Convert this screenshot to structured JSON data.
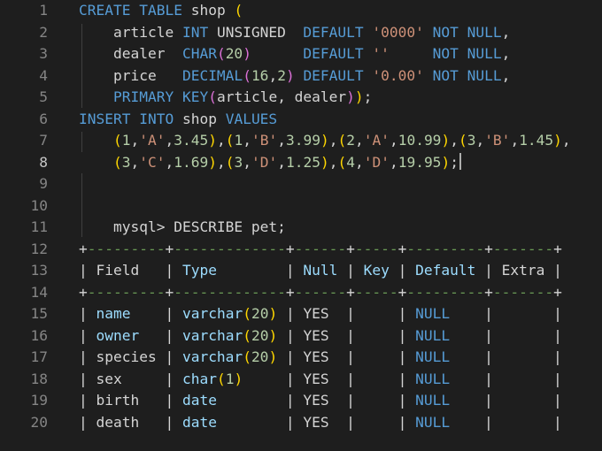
{
  "editor": {
    "current_line": 8,
    "lines": [
      {
        "n": "1",
        "tokens": [
          {
            "t": "CREATE",
            "c": "kw"
          },
          {
            "t": " ",
            "c": "pl"
          },
          {
            "t": "TABLE",
            "c": "kw"
          },
          {
            "t": " shop ",
            "c": "pl"
          },
          {
            "t": "(",
            "c": "br1"
          }
        ]
      },
      {
        "n": "2",
        "tokens": [
          {
            "t": "    article ",
            "c": "pl"
          },
          {
            "t": "INT",
            "c": "kw"
          },
          {
            "t": " UNSIGNED  ",
            "c": "pl"
          },
          {
            "t": "DEFAULT",
            "c": "kw"
          },
          {
            "t": " ",
            "c": "pl"
          },
          {
            "t": "'0000'",
            "c": "st"
          },
          {
            "t": " ",
            "c": "pl"
          },
          {
            "t": "NOT",
            "c": "kw"
          },
          {
            "t": " ",
            "c": "pl"
          },
          {
            "t": "NULL",
            "c": "kw"
          },
          {
            "t": ",",
            "c": "pl"
          }
        ]
      },
      {
        "n": "3",
        "tokens": [
          {
            "t": "    dealer  ",
            "c": "pl"
          },
          {
            "t": "CHAR",
            "c": "kw"
          },
          {
            "t": "(",
            "c": "br2"
          },
          {
            "t": "20",
            "c": "nu"
          },
          {
            "t": ")",
            "c": "br2"
          },
          {
            "t": "      ",
            "c": "pl"
          },
          {
            "t": "DEFAULT",
            "c": "kw"
          },
          {
            "t": " ",
            "c": "pl"
          },
          {
            "t": "''",
            "c": "st"
          },
          {
            "t": "     ",
            "c": "pl"
          },
          {
            "t": "NOT",
            "c": "kw"
          },
          {
            "t": " ",
            "c": "pl"
          },
          {
            "t": "NULL",
            "c": "kw"
          },
          {
            "t": ",",
            "c": "pl"
          }
        ]
      },
      {
        "n": "4",
        "tokens": [
          {
            "t": "    price   ",
            "c": "pl"
          },
          {
            "t": "DECIMAL",
            "c": "kw"
          },
          {
            "t": "(",
            "c": "br2"
          },
          {
            "t": "16",
            "c": "nu"
          },
          {
            "t": ",",
            "c": "pl"
          },
          {
            "t": "2",
            "c": "nu"
          },
          {
            "t": ")",
            "c": "br2"
          },
          {
            "t": " ",
            "c": "pl"
          },
          {
            "t": "DEFAULT",
            "c": "kw"
          },
          {
            "t": " ",
            "c": "pl"
          },
          {
            "t": "'0.00'",
            "c": "st"
          },
          {
            "t": " ",
            "c": "pl"
          },
          {
            "t": "NOT",
            "c": "kw"
          },
          {
            "t": " ",
            "c": "pl"
          },
          {
            "t": "NULL",
            "c": "kw"
          },
          {
            "t": ",",
            "c": "pl"
          }
        ]
      },
      {
        "n": "5",
        "tokens": [
          {
            "t": "    ",
            "c": "pl"
          },
          {
            "t": "PRIMARY",
            "c": "kw"
          },
          {
            "t": " ",
            "c": "pl"
          },
          {
            "t": "KEY",
            "c": "kw"
          },
          {
            "t": "(",
            "c": "br2"
          },
          {
            "t": "article, dealer",
            "c": "pl"
          },
          {
            "t": ")",
            "c": "br2"
          },
          {
            "t": ")",
            "c": "br1"
          },
          {
            "t": ";",
            "c": "pl"
          }
        ]
      },
      {
        "n": "6",
        "tokens": [
          {
            "t": "INSERT",
            "c": "kw"
          },
          {
            "t": " ",
            "c": "pl"
          },
          {
            "t": "INTO",
            "c": "kw"
          },
          {
            "t": " shop ",
            "c": "pl"
          },
          {
            "t": "VALUES",
            "c": "kw"
          }
        ]
      },
      {
        "n": "7",
        "tokens": [
          {
            "t": "    ",
            "c": "pl"
          },
          {
            "t": "(",
            "c": "br1"
          },
          {
            "t": "1",
            "c": "nu"
          },
          {
            "t": ",",
            "c": "pl"
          },
          {
            "t": "'A'",
            "c": "st"
          },
          {
            "t": ",",
            "c": "pl"
          },
          {
            "t": "3.45",
            "c": "nu"
          },
          {
            "t": ")",
            "c": "br1"
          },
          {
            "t": ",",
            "c": "pl"
          },
          {
            "t": "(",
            "c": "br1"
          },
          {
            "t": "1",
            "c": "nu"
          },
          {
            "t": ",",
            "c": "pl"
          },
          {
            "t": "'B'",
            "c": "st"
          },
          {
            "t": ",",
            "c": "pl"
          },
          {
            "t": "3.99",
            "c": "nu"
          },
          {
            "t": ")",
            "c": "br1"
          },
          {
            "t": ",",
            "c": "pl"
          },
          {
            "t": "(",
            "c": "br1"
          },
          {
            "t": "2",
            "c": "nu"
          },
          {
            "t": ",",
            "c": "pl"
          },
          {
            "t": "'A'",
            "c": "st"
          },
          {
            "t": ",",
            "c": "pl"
          },
          {
            "t": "10.99",
            "c": "nu"
          },
          {
            "t": ")",
            "c": "br1"
          },
          {
            "t": ",",
            "c": "pl"
          },
          {
            "t": "(",
            "c": "br1"
          },
          {
            "t": "3",
            "c": "nu"
          },
          {
            "t": ",",
            "c": "pl"
          },
          {
            "t": "'B'",
            "c": "st"
          },
          {
            "t": ",",
            "c": "pl"
          },
          {
            "t": "1.45",
            "c": "nu"
          },
          {
            "t": ")",
            "c": "br1"
          },
          {
            "t": ",",
            "c": "pl"
          }
        ]
      },
      {
        "n": "8",
        "cursor": true,
        "tokens": [
          {
            "t": "    ",
            "c": "pl"
          },
          {
            "t": "(",
            "c": "br1"
          },
          {
            "t": "3",
            "c": "nu"
          },
          {
            "t": ",",
            "c": "pl"
          },
          {
            "t": "'C'",
            "c": "st"
          },
          {
            "t": ",",
            "c": "pl"
          },
          {
            "t": "1.69",
            "c": "nu"
          },
          {
            "t": ")",
            "c": "br1"
          },
          {
            "t": ",",
            "c": "pl"
          },
          {
            "t": "(",
            "c": "br1"
          },
          {
            "t": "3",
            "c": "nu"
          },
          {
            "t": ",",
            "c": "pl"
          },
          {
            "t": "'D'",
            "c": "st"
          },
          {
            "t": ",",
            "c": "pl"
          },
          {
            "t": "1.25",
            "c": "nu"
          },
          {
            "t": ")",
            "c": "br1"
          },
          {
            "t": ",",
            "c": "pl"
          },
          {
            "t": "(",
            "c": "br1"
          },
          {
            "t": "4",
            "c": "nu"
          },
          {
            "t": ",",
            "c": "pl"
          },
          {
            "t": "'D'",
            "c": "st"
          },
          {
            "t": ",",
            "c": "pl"
          },
          {
            "t": "19.95",
            "c": "nu"
          },
          {
            "t": ")",
            "c": "br1"
          },
          {
            "t": ";",
            "c": "pl"
          }
        ]
      },
      {
        "n": "9",
        "tokens": []
      },
      {
        "n": "10",
        "tokens": []
      },
      {
        "n": "11",
        "tokens": [
          {
            "t": "    mysql> DESCRIBE pet;",
            "c": "pl"
          }
        ]
      },
      {
        "n": "12",
        "tokens": [
          {
            "t": "+",
            "c": "pl"
          },
          {
            "t": "---------",
            "c": "grn"
          },
          {
            "t": "+",
            "c": "pl"
          },
          {
            "t": "-------------",
            "c": "grn"
          },
          {
            "t": "+",
            "c": "pl"
          },
          {
            "t": "------",
            "c": "grn"
          },
          {
            "t": "+",
            "c": "pl"
          },
          {
            "t": "-----",
            "c": "grn"
          },
          {
            "t": "+",
            "c": "pl"
          },
          {
            "t": "---------",
            "c": "grn"
          },
          {
            "t": "+",
            "c": "pl"
          },
          {
            "t": "-------",
            "c": "grn"
          },
          {
            "t": "+",
            "c": "pl"
          }
        ]
      },
      {
        "n": "13",
        "tokens": [
          {
            "t": "| Field   | ",
            "c": "pl"
          },
          {
            "t": "Type",
            "c": "id"
          },
          {
            "t": "        | ",
            "c": "pl"
          },
          {
            "t": "Null",
            "c": "id"
          },
          {
            "t": " | ",
            "c": "pl"
          },
          {
            "t": "Key",
            "c": "id"
          },
          {
            "t": " | ",
            "c": "pl"
          },
          {
            "t": "Default",
            "c": "id"
          },
          {
            "t": " | Extra |",
            "c": "pl"
          }
        ]
      },
      {
        "n": "14",
        "tokens": [
          {
            "t": "+",
            "c": "pl"
          },
          {
            "t": "---------",
            "c": "grn"
          },
          {
            "t": "+",
            "c": "pl"
          },
          {
            "t": "-------------",
            "c": "grn"
          },
          {
            "t": "+",
            "c": "pl"
          },
          {
            "t": "------",
            "c": "grn"
          },
          {
            "t": "+",
            "c": "pl"
          },
          {
            "t": "-----",
            "c": "grn"
          },
          {
            "t": "+",
            "c": "pl"
          },
          {
            "t": "---------",
            "c": "grn"
          },
          {
            "t": "+",
            "c": "pl"
          },
          {
            "t": "-------",
            "c": "grn"
          },
          {
            "t": "+",
            "c": "pl"
          }
        ]
      },
      {
        "n": "15",
        "tokens": [
          {
            "t": "| ",
            "c": "pl"
          },
          {
            "t": "name",
            "c": "id"
          },
          {
            "t": "    | ",
            "c": "pl"
          },
          {
            "t": "varchar",
            "c": "id"
          },
          {
            "t": "(",
            "c": "br1"
          },
          {
            "t": "20",
            "c": "nu"
          },
          {
            "t": ")",
            "c": "br1"
          },
          {
            "t": " | YES  |     | ",
            "c": "pl"
          },
          {
            "t": "NULL",
            "c": "kw"
          },
          {
            "t": "    |       |",
            "c": "pl"
          }
        ]
      },
      {
        "n": "16",
        "tokens": [
          {
            "t": "| ",
            "c": "pl"
          },
          {
            "t": "owner",
            "c": "id"
          },
          {
            "t": "   | ",
            "c": "pl"
          },
          {
            "t": "varchar",
            "c": "id"
          },
          {
            "t": "(",
            "c": "br1"
          },
          {
            "t": "20",
            "c": "nu"
          },
          {
            "t": ")",
            "c": "br1"
          },
          {
            "t": " | YES  |     | ",
            "c": "pl"
          },
          {
            "t": "NULL",
            "c": "kw"
          },
          {
            "t": "    |       |",
            "c": "pl"
          }
        ]
      },
      {
        "n": "17",
        "tokens": [
          {
            "t": "| species | ",
            "c": "pl"
          },
          {
            "t": "varchar",
            "c": "id"
          },
          {
            "t": "(",
            "c": "br1"
          },
          {
            "t": "20",
            "c": "nu"
          },
          {
            "t": ")",
            "c": "br1"
          },
          {
            "t": " | YES  |     | ",
            "c": "pl"
          },
          {
            "t": "NULL",
            "c": "kw"
          },
          {
            "t": "    |       |",
            "c": "pl"
          }
        ]
      },
      {
        "n": "18",
        "tokens": [
          {
            "t": "| sex     | ",
            "c": "pl"
          },
          {
            "t": "char",
            "c": "id"
          },
          {
            "t": "(",
            "c": "br1"
          },
          {
            "t": "1",
            "c": "nu"
          },
          {
            "t": ")",
            "c": "br1"
          },
          {
            "t": "     | YES  |     | ",
            "c": "pl"
          },
          {
            "t": "NULL",
            "c": "kw"
          },
          {
            "t": "    |       |",
            "c": "pl"
          }
        ]
      },
      {
        "n": "19",
        "tokens": [
          {
            "t": "| birth   | ",
            "c": "pl"
          },
          {
            "t": "date",
            "c": "id"
          },
          {
            "t": "        | YES  |     | ",
            "c": "pl"
          },
          {
            "t": "NULL",
            "c": "kw"
          },
          {
            "t": "    |       |",
            "c": "pl"
          }
        ]
      },
      {
        "n": "20",
        "tokens": [
          {
            "t": "| death   | ",
            "c": "pl"
          },
          {
            "t": "date",
            "c": "id"
          },
          {
            "t": "        | YES  |     | ",
            "c": "pl"
          },
          {
            "t": "NULL",
            "c": "kw"
          },
          {
            "t": "    |       |",
            "c": "pl"
          }
        ]
      }
    ]
  }
}
